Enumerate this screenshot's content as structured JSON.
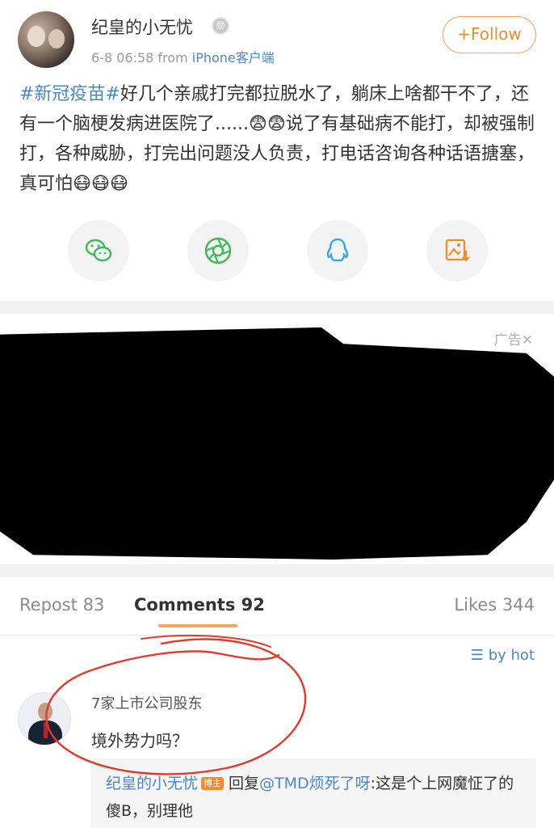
{
  "post": {
    "username": "纪皇的小无忧",
    "medal": "勋",
    "time": "6-8 06:58",
    "from_prefix": "from",
    "source": "iPhone客户端",
    "follow": "+Follow",
    "tag": "#新冠疫苗#",
    "text": "好几个亲戚打完都拉脱水了，躺床上啥都干不了，还有一个脑梗发病进医院了......😨😨说了有基础病不能打，却被强制打，各种威胁，打完出问题没人负责，打电话咨询各种话语搪塞，真可怕😷😷😷"
  },
  "share": [
    {
      "name": "wechat",
      "icon": "wechat-icon",
      "color": "#3fb85b"
    },
    {
      "name": "moments",
      "icon": "moments-icon",
      "color": "#3fb85b"
    },
    {
      "name": "qq",
      "icon": "qq-icon",
      "color": "#2fa5f2"
    },
    {
      "name": "save-image",
      "icon": "save-image-icon",
      "color": "#f08b2a"
    }
  ],
  "ad": {
    "label": "广告✕"
  },
  "tabs": {
    "repost": "Repost 83",
    "comments": "Comments 92",
    "likes": "Likes 344"
  },
  "sort": {
    "label": "by hot",
    "icon": "sort-icon"
  },
  "comment": {
    "name": "7家上市公司股东",
    "text": "境外势力吗？",
    "reply": {
      "name": "纪皇的小无忧",
      "badge": "博主",
      "prefix": "回复",
      "at": "@TMD烦死了呀",
      "text": ":这是个上网魔怔了的傻B，别理他"
    }
  },
  "colors": {
    "accent": "#f08b2a",
    "link": "#4a87c7",
    "annotation": "#e03a2a"
  }
}
